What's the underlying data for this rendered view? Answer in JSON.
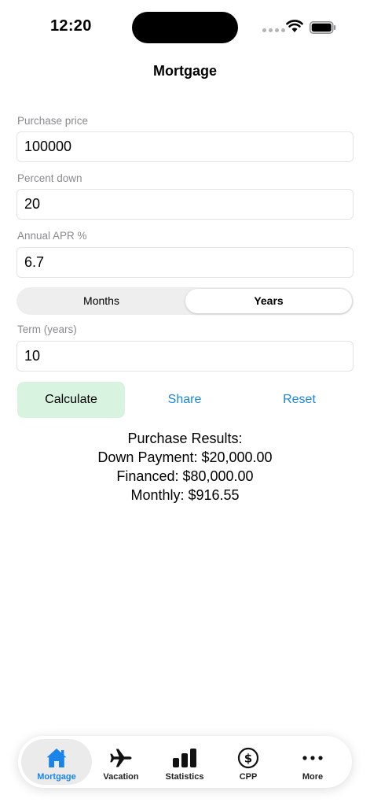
{
  "status_bar": {
    "time": "12:20"
  },
  "header": {
    "title": "Mortgage"
  },
  "form": {
    "purchase_price": {
      "label": "Purchase price",
      "value": "100000"
    },
    "percent_down": {
      "label": "Percent down",
      "value": "20"
    },
    "annual_apr": {
      "label": "Annual APR %",
      "value": "6.7"
    },
    "term_unit": {
      "options": [
        "Months",
        "Years"
      ],
      "selected": "Years"
    },
    "term": {
      "label": "Term (years)",
      "value": "10"
    }
  },
  "actions": {
    "calculate": "Calculate",
    "share": "Share",
    "reset": "Reset"
  },
  "results": {
    "heading": "Purchase Results:",
    "down_payment": "Down Payment: $20,000.00",
    "financed": "Financed: $80,000.00",
    "monthly": "Monthly: $916.55"
  },
  "tab_bar": {
    "active": "Mortgage",
    "items": [
      {
        "label": "Mortgage",
        "icon": "house-icon"
      },
      {
        "label": "Vacation",
        "icon": "airplane-icon"
      },
      {
        "label": "Statistics",
        "icon": "bar-chart-icon"
      },
      {
        "label": "CPP",
        "icon": "dollar-circle-icon"
      },
      {
        "label": "More",
        "icon": "ellipsis-icon"
      }
    ]
  },
  "colors": {
    "accent": "#1a84e8",
    "calculate_bg": "#d9f3e1",
    "label_gray": "#8a8a8e"
  }
}
